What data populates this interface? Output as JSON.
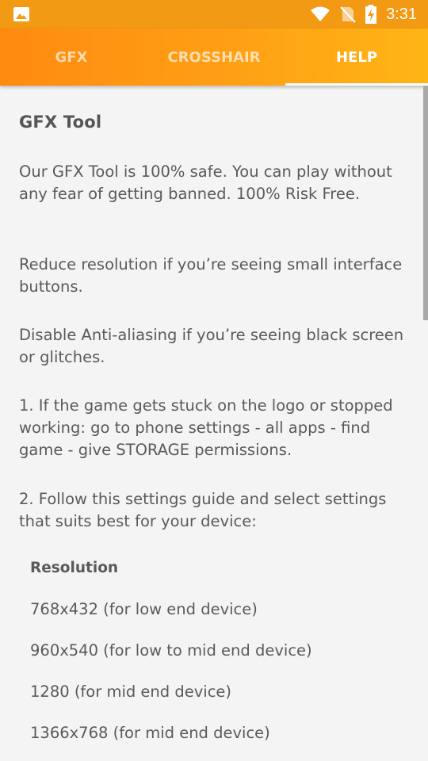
{
  "status_bar": {
    "time": "3:31",
    "icons": [
      "image-icon",
      "wifi-icon",
      "no-sim-icon",
      "battery-charging-icon"
    ]
  },
  "tabs": [
    {
      "label": "GFX",
      "active": false
    },
    {
      "label": "CROSSHAIR",
      "active": false
    },
    {
      "label": "HELP",
      "active": true
    }
  ],
  "help": {
    "title": "GFX Tool",
    "paragraphs": [
      "Our GFX Tool is 100% safe. You can play without any fear of getting banned. 100% Risk Free.",
      "Reduce resolution if you’re seeing small interface buttons.",
      "Disable Anti-aliasing if you’re seeing black screen or glitches.",
      "1. If the game gets stuck on the logo or stopped working: go to phone settings - all apps - find game -  give STORAGE permissions.",
      "2. Follow this settings guide and select settings that suits best for your device:"
    ],
    "resolution_heading": "Resolution",
    "resolutions": [
      "768x432 (for low end device)",
      "960x540 (for low to mid end device)",
      "1280 (for mid end device)",
      "1366x768 (for mid end device)"
    ]
  },
  "colors": {
    "status_bar": "#f39a14",
    "tab_gradient_start": "#ff8a10",
    "tab_gradient_end": "#ffb515",
    "background": "#f4f4f4",
    "text": "#5a5a5a"
  }
}
